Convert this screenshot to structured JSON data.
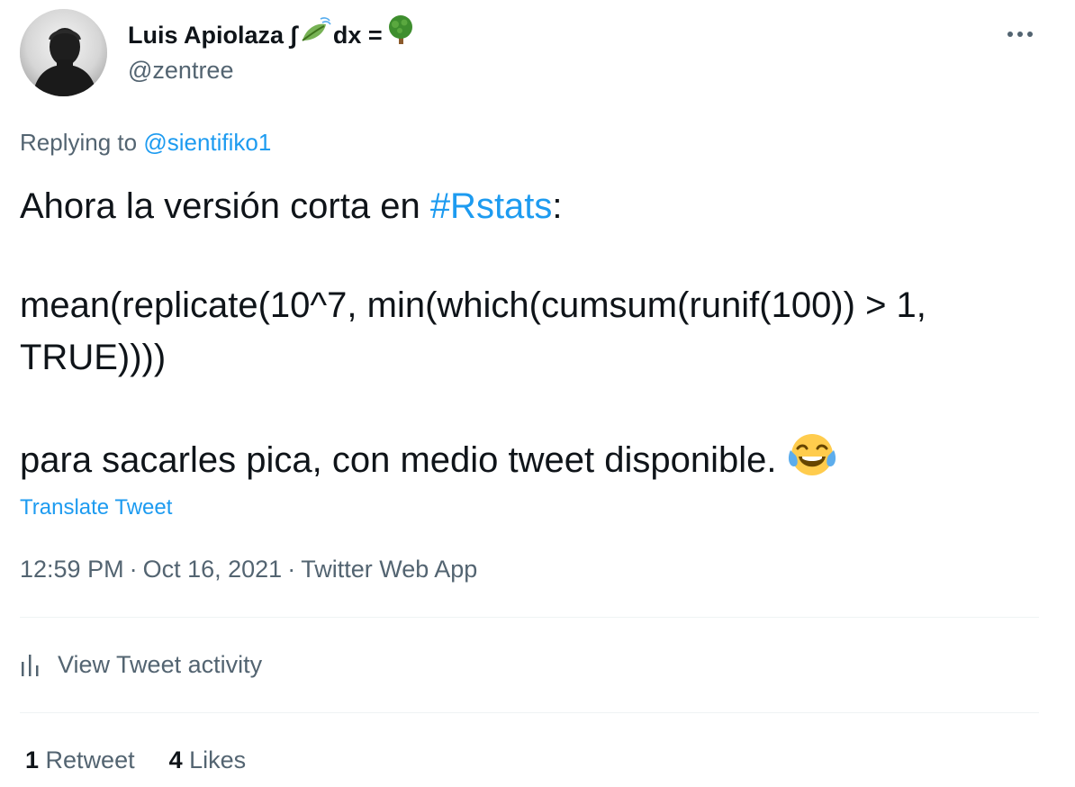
{
  "author": {
    "name_text": "Luis Apiolaza ∫",
    "name_suffix": "dx =",
    "handle": "@zentree"
  },
  "reply": {
    "prefix": "Replying to ",
    "to_handle": "@sientifiko1"
  },
  "tweet": {
    "line1_text": "Ahora la versión corta en ",
    "hashtag": "#Rstats",
    "line1_end": ":",
    "code": "mean(replicate(10^7, min(which(cumsum(runif(100)) > 1, TRUE))))",
    "line3": "para sacarles pica, con medio tweet disponible. "
  },
  "translate_label": "Translate Tweet",
  "meta": {
    "time": "12:59 PM",
    "date": "Oct 16, 2021",
    "source": "Twitter Web App",
    "separator": "·"
  },
  "activity_label": "View Tweet activity",
  "stats": {
    "retweets_count": "1",
    "retweets_label": "Retweet",
    "likes_count": "4",
    "likes_label": "Likes"
  },
  "icons": {
    "name_leaf": "leaf-icon",
    "name_tree": "tree-icon",
    "more": "more-options-icon",
    "activity": "bar-chart-icon",
    "emoji": "laughing-crying-emoji-icon"
  },
  "colors": {
    "link": "#1d9bf0",
    "text": "#0f1419",
    "secondary": "#536471",
    "divider": "#eff3f4"
  }
}
